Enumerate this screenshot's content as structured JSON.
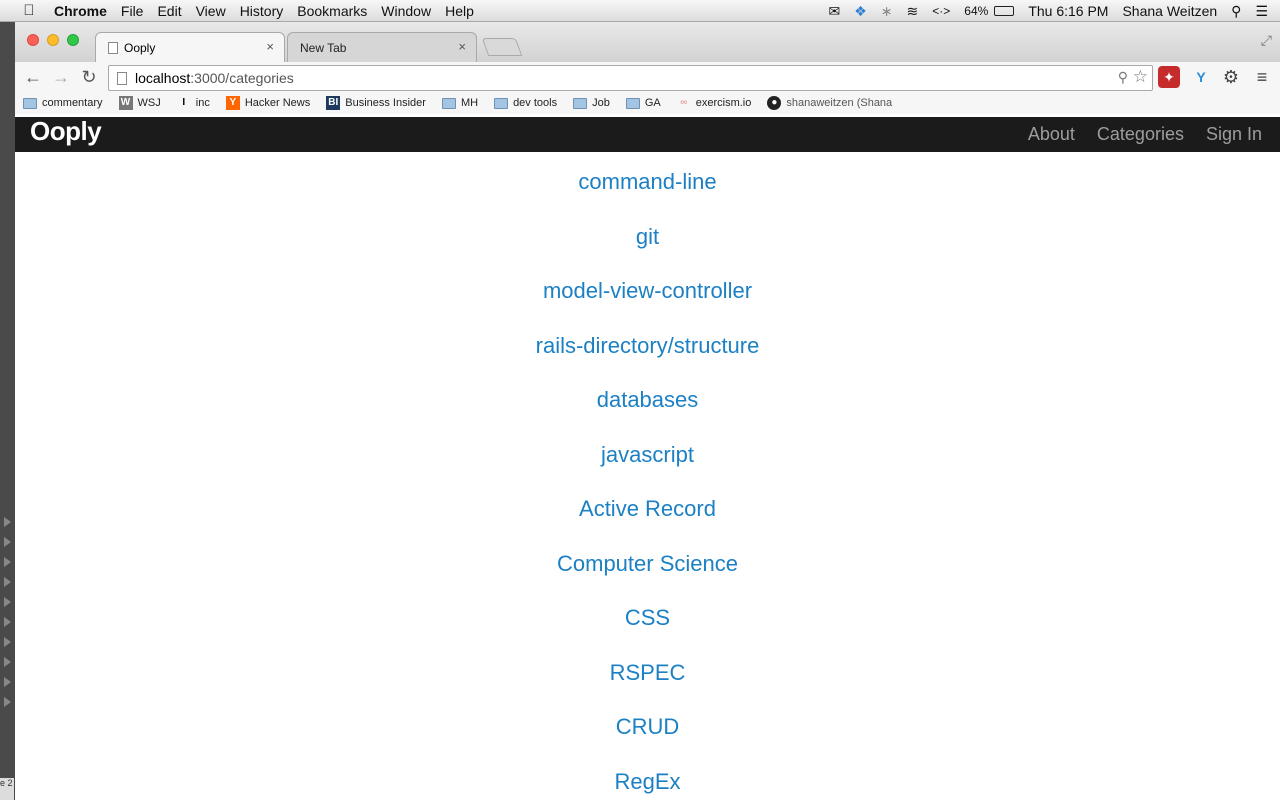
{
  "menubar": {
    "app_name": "Chrome",
    "items": [
      "File",
      "Edit",
      "View",
      "History",
      "Bookmarks",
      "Window",
      "Help"
    ],
    "status": {
      "arrows": "<·>",
      "battery": "64%",
      "clock": "Thu 6:16 PM",
      "user": "Shana Weitzen"
    }
  },
  "tabs": [
    {
      "title": "Ooply",
      "close": "×"
    },
    {
      "title": "New Tab",
      "close": "×"
    }
  ],
  "omnibox": {
    "host": "localhost",
    "path": ":3000/categories"
  },
  "bookmarks": [
    {
      "label": "commentary",
      "icon": "folder-icon"
    },
    {
      "label": "WSJ",
      "icon": "wsj-icon"
    },
    {
      "label": "inc",
      "icon": "inc-icon"
    },
    {
      "label": "Hacker News",
      "icon": "y-icon"
    },
    {
      "label": "Business Insider",
      "icon": "bi-icon"
    },
    {
      "label": "MH",
      "icon": "folder-icon"
    },
    {
      "label": "dev tools",
      "icon": "folder-icon"
    },
    {
      "label": "Job",
      "icon": "folder-icon"
    },
    {
      "label": "GA",
      "icon": "folder-icon"
    },
    {
      "label": "exercism.io",
      "icon": "exercism-icon"
    },
    {
      "label": "shanaweitzen (Shana",
      "icon": "github-icon"
    }
  ],
  "site": {
    "brand": "Ooply",
    "nav": [
      "About",
      "Categories",
      "Sign In"
    ],
    "nav_color": "#9d9d9d",
    "link_color": "#1c80c5"
  },
  "categories": [
    "command-line",
    "git",
    "model-view-controller",
    "rails-directory/structure",
    "databases",
    "javascript",
    "Active Record",
    "Computer Science",
    "CSS",
    "RSPEC",
    "CRUD",
    "RegEx"
  ],
  "desktop_edge_text": "e 2"
}
